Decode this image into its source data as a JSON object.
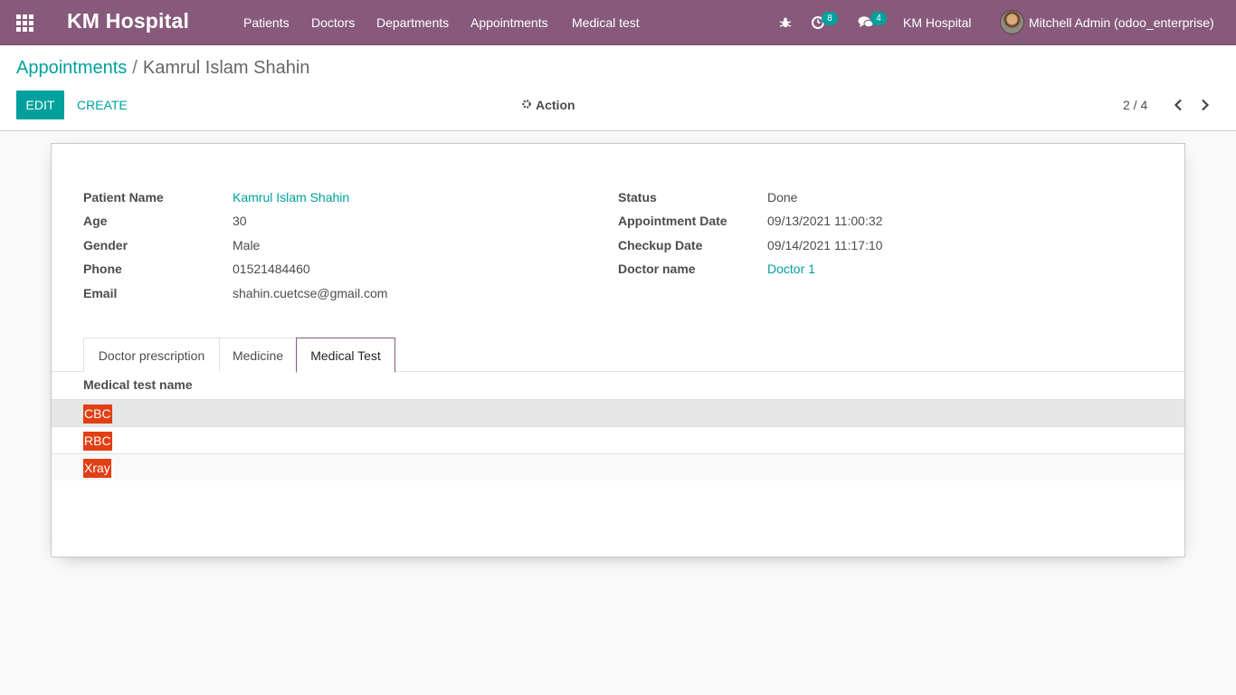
{
  "app": {
    "brand": "KM Hospital",
    "menu": [
      "Patients",
      "Doctors",
      "Departments",
      "Appointments",
      "Medical test"
    ]
  },
  "systray": {
    "activity_count": "8",
    "message_count": "4",
    "company": "KM Hospital",
    "user": "Mitchell Admin (odoo_enterprise)"
  },
  "breadcrumb": {
    "parent": "Appointments",
    "separator": "/",
    "current": "Kamrul Islam Shahin"
  },
  "buttons": {
    "edit": "Edit",
    "create": "Create",
    "action": "Action"
  },
  "pager": {
    "value": "2 / 4"
  },
  "form": {
    "left": [
      {
        "label": "Patient Name",
        "value": "Kamrul Islam Shahin",
        "link": true
      },
      {
        "label": "Age",
        "value": "30",
        "link": false
      },
      {
        "label": "Gender",
        "value": "Male",
        "link": false
      },
      {
        "label": "Phone",
        "value": "01521484460",
        "link": false
      },
      {
        "label": "Email",
        "value": "shahin.cuetcse@gmail.com",
        "link": false
      }
    ],
    "right": [
      {
        "label": "Status",
        "value": "Done",
        "link": false
      },
      {
        "label": "Appointment Date",
        "value": "09/13/2021 11:00:32",
        "link": false
      },
      {
        "label": "Checkup Date",
        "value": "09/14/2021 11:17:10",
        "link": false
      },
      {
        "label": "Doctor name",
        "value": "Doctor 1",
        "link": true
      }
    ]
  },
  "tabs": [
    "Doctor prescription",
    "Medicine",
    "Medical Test"
  ],
  "active_tab": "Medical Test",
  "medical_tests": {
    "header": "Medical test name",
    "rows": [
      "CBC",
      "RBC",
      "Xray"
    ]
  },
  "colors": {
    "navbar": "#875a7b",
    "primary": "#00a09d",
    "tag": "#e23f14"
  }
}
